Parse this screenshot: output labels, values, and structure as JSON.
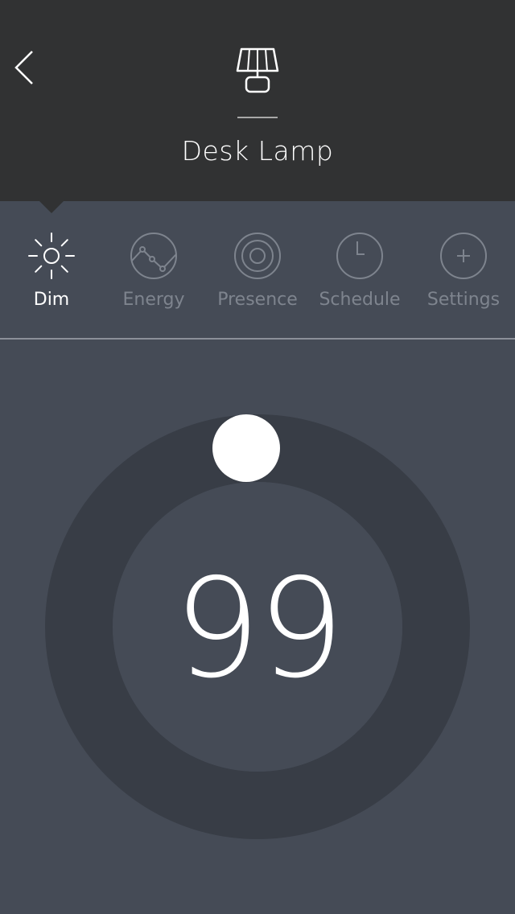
{
  "header": {
    "device_name": "Desk Lamp",
    "device_icon": "desk-lamp-icon",
    "back_icon": "chevron-left-icon"
  },
  "tabs": [
    {
      "label": "Dim",
      "icon": "sun-icon",
      "active": true
    },
    {
      "label": "Energy",
      "icon": "line-graph-icon",
      "active": false
    },
    {
      "label": "Presence",
      "icon": "concentric-circles-icon",
      "active": false
    },
    {
      "label": "Schedule",
      "icon": "clock-icon",
      "active": false
    },
    {
      "label": "Settings",
      "icon": "plus-icon",
      "active": false
    }
  ],
  "dimmer": {
    "value": "99",
    "level_percent": 99
  },
  "colors": {
    "header_bg": "#313233",
    "body_bg": "#454b56",
    "dial_ring": "#383d46",
    "active": "#ffffff",
    "inactive": "#7e848e"
  }
}
